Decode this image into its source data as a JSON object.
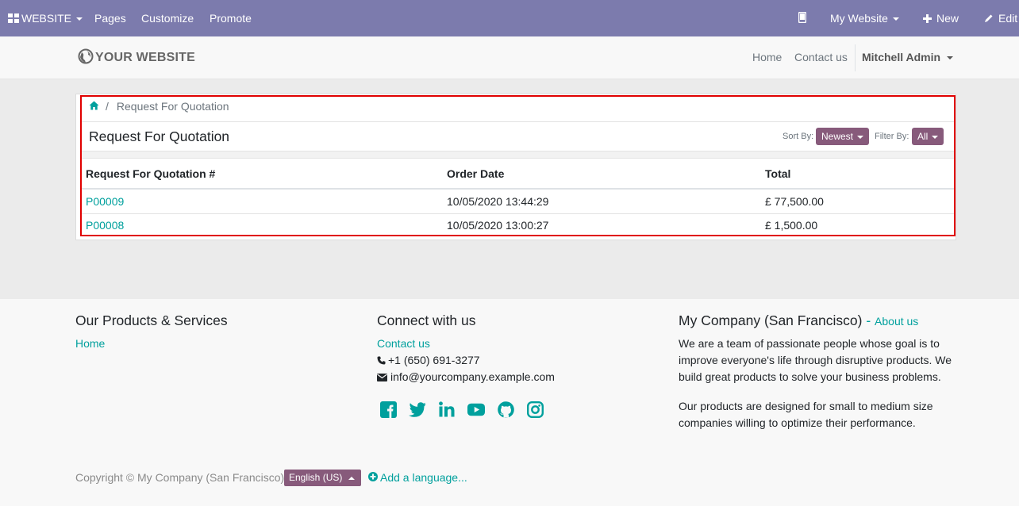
{
  "topbar": {
    "website_menu": "WEBSITE",
    "pages": "Pages",
    "customize": "Customize",
    "promote": "Promote",
    "my_website": "My Website",
    "new": "New",
    "edit": "Edit"
  },
  "header": {
    "logo_text": "YOUR WEBSITE",
    "nav": [
      "Home",
      "Contact us"
    ],
    "user": "Mitchell Admin"
  },
  "breadcrumb": {
    "current": "Request For Quotation",
    "separator": "/"
  },
  "portal": {
    "title": "Request For Quotation",
    "sort_label": "Sort By:",
    "sort_value": "Newest",
    "filter_label": "Filter By:",
    "filter_value": "All",
    "columns": [
      "Request For Quotation #",
      "Order Date",
      "Total"
    ],
    "rows": [
      {
        "ref": "P00009",
        "date": "10/05/2020 13:44:29",
        "total": "£ 77,500.00"
      },
      {
        "ref": "P00008",
        "date": "10/05/2020 13:00:27",
        "total": "£ 1,500.00"
      }
    ]
  },
  "footer": {
    "col1_title": "Our Products & Services",
    "col1_link": "Home",
    "col2_title": "Connect with us",
    "col2_contact": "Contact us",
    "phone": "+1 (650) 691-3277",
    "email": "info@yourcompany.example.com",
    "col3_title": "My Company (San Francisco)",
    "col3_dash": " - ",
    "col3_link": "About us",
    "about_p1": "We are a team of passionate people whose goal is to improve everyone's life through disruptive products. We build great products to solve your business problems.",
    "about_p2": "Our products are designed for small to medium size companies willing to optimize their performance.",
    "copyright": "Copyright © My Company (San Francisco)",
    "language": "English (US)",
    "add_language": "Add a language..."
  },
  "colors": {
    "topbar": "#7c7bad",
    "accent_teal": "#00a09d",
    "button_purple": "#875a7b",
    "highlight_red": "#e00000"
  },
  "icons": {
    "social": [
      "facebook-icon",
      "twitter-icon",
      "linkedin-icon",
      "youtube-icon",
      "github-icon",
      "instagram-icon"
    ]
  }
}
